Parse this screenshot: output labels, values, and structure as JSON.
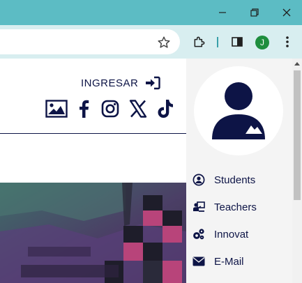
{
  "window": {
    "controls": {
      "minimize": "minimize-icon",
      "maximize": "restore-icon",
      "close": "close-icon"
    }
  },
  "toolbar": {
    "profile_initial": "J",
    "icons": [
      "star-icon",
      "extensions-icon",
      "side-panel-icon",
      "more-menu-icon"
    ]
  },
  "header": {
    "login_label": "INGRESAR",
    "social": [
      "gallery-icon",
      "facebook-icon",
      "instagram-icon",
      "x-icon",
      "tiktok-icon"
    ]
  },
  "sidebar": {
    "items": [
      {
        "label": "Students",
        "icon": "user-circle-icon"
      },
      {
        "label": "Teachers",
        "icon": "teacher-icon"
      },
      {
        "label": "Innovat",
        "icon": "gears-icon"
      },
      {
        "label": "E-Mail",
        "icon": "envelope-icon"
      }
    ]
  },
  "colors": {
    "titlebar": "#5cbcc4",
    "toolbar": "#d8eef0",
    "brand_navy": "#0d1446",
    "panel_bg": "#f4f4f4"
  }
}
